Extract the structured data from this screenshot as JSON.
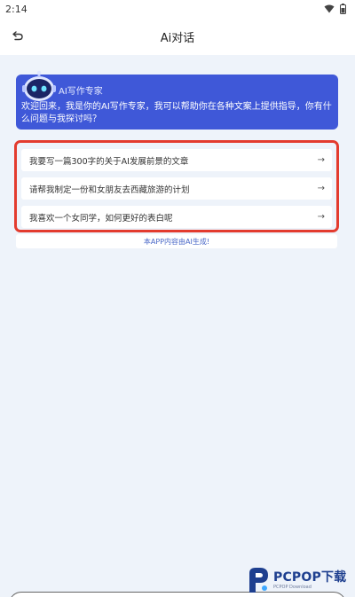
{
  "status_bar": {
    "time": "2:14"
  },
  "header": {
    "title": "Ai对话"
  },
  "welcome": {
    "title": "AI写作专家",
    "message": "欢迎回来，我是你的AI写作专家，我可以帮助你在各种文案上提供指导，你有什么问题与我探讨吗？"
  },
  "suggestions": [
    {
      "text": "我要写一篇300字的关于AI发展前景的文章",
      "arrow": "→"
    },
    {
      "text": "请帮我制定一份和女朋友去西藏旅游的计划",
      "arrow": "→"
    },
    {
      "text": "我喜欢一个女同学，如何更好的表白呢",
      "arrow": "→"
    }
  ],
  "disclaimer": "本APP内容由AI生成!",
  "watermark": {
    "text": "PCPOP下载",
    "sub": "PCPOP Download"
  },
  "colors": {
    "card_blue": "#3f58d8",
    "highlight_red": "#e33b2e",
    "background": "#eef3fa",
    "disclaimer_text": "#4a68c8"
  },
  "icons": [
    "wifi-icon",
    "battery-icon",
    "back-arrow-icon",
    "robot-avatar-icon",
    "arrow-right-icon"
  ]
}
